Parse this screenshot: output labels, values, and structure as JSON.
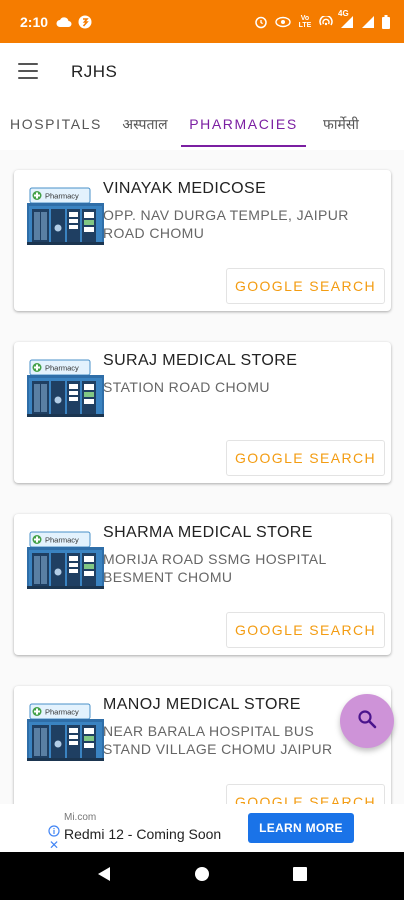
{
  "status_bar": {
    "time": "2:10",
    "network_label": "4G",
    "volte_label": "Vo LTE"
  },
  "app_bar": {
    "title": "RJHS",
    "menu_icon": "hamburger-menu-icon"
  },
  "tabs": [
    {
      "label": "HOSPITALS",
      "active": false
    },
    {
      "label": "अस्पताल",
      "active": false
    },
    {
      "label": "PHARMACIES",
      "active": true
    },
    {
      "label": "फार्मेसी",
      "active": false
    }
  ],
  "pharmacies": [
    {
      "name": "VINAYAK MEDICOSE",
      "address": "OPP. NAV DURGA TEMPLE, JAIPUR ROAD CHOMU",
      "button": "GOOGLE SEARCH"
    },
    {
      "name": "SURAJ MEDICAL STORE",
      "address": "STATION ROAD CHOMU",
      "button": "GOOGLE SEARCH"
    },
    {
      "name": "SHARMA MEDICAL STORE",
      "address": "MORIJA ROAD SSMG HOSPITAL BESMENT CHOMU",
      "button": "GOOGLE SEARCH"
    },
    {
      "name": "MANOJ MEDICAL STORE",
      "address": "NEAR BARALA HOSPITAL BUS STAND VILLAGE CHOMU JAIPUR",
      "button": "GOOGLE SEARCH"
    }
  ],
  "thumbnail_label": "Pharmacy",
  "ad": {
    "domain": "Mi.com",
    "title": "Redmi 12 - Coming Soon",
    "cta": "LEARN MORE"
  },
  "colors": {
    "status_bar": "#f57c00",
    "tab_active": "#7b1fa2",
    "button_text": "#f39c12",
    "fab": "#ce93d8",
    "ad_cta": "#1a73e8"
  }
}
